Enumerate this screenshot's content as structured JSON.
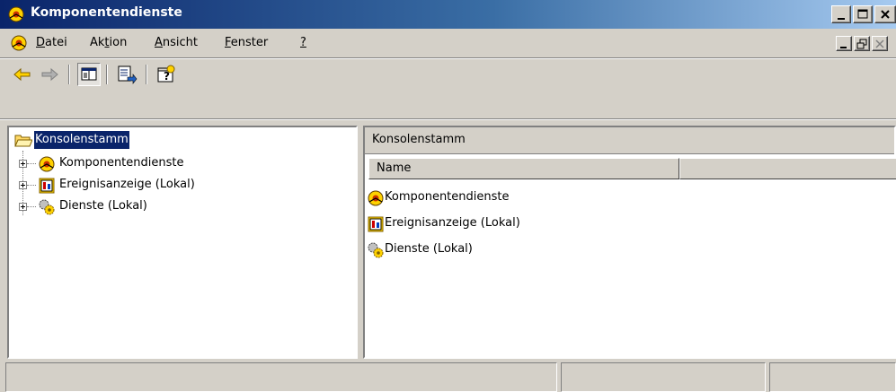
{
  "window": {
    "title": "Komponentendienste",
    "title_bar_color": "#0a246a",
    "app_icon": "component-services-icon"
  },
  "caption_buttons": [
    "minimize-icon",
    "maximize-icon",
    "close-icon"
  ],
  "menu": {
    "doc_icon": "component-services-icon",
    "items": [
      {
        "pre": "",
        "accel": "D",
        "post": "atei"
      },
      {
        "pre": "Ak",
        "accel": "t",
        "post": "ion"
      },
      {
        "pre": "",
        "accel": "A",
        "post": "nsicht"
      },
      {
        "pre": "",
        "accel": "F",
        "post": "enster"
      },
      {
        "pre": "",
        "accel": "?",
        "post": ""
      }
    ],
    "mdi_buttons": [
      "minimize-icon",
      "restore-icon",
      "close-icon"
    ]
  },
  "toolbar": {
    "buttons": [
      "back-arrow-icon",
      "forward-arrow-icon",
      "show-hide-tree-icon",
      "export-list-icon",
      "help-icon"
    ]
  },
  "tree": {
    "root": {
      "label": "Konsolenstamm",
      "icon": "folder-open-icon"
    },
    "items": [
      {
        "label": "Komponentendienste",
        "icon": "component-services-icon"
      },
      {
        "label": "Ereignisanzeige (Lokal)",
        "icon": "event-viewer-icon"
      },
      {
        "label": "Dienste (Lokal)",
        "icon": "services-gears-icon"
      }
    ]
  },
  "detail": {
    "caption": "Konsolenstamm",
    "columns": [
      "Name",
      ""
    ],
    "items": [
      {
        "label": "Komponentendienste",
        "icon": "component-services-icon"
      },
      {
        "label": "Ereignisanzeige (Lokal)",
        "icon": "event-viewer-icon"
      },
      {
        "label": "Dienste (Lokal)",
        "icon": "services-gears-icon"
      }
    ]
  },
  "statusbar": {
    "cells": [
      "",
      "",
      ""
    ]
  },
  "colors": {
    "face": "#d4d0c8",
    "selection": "#0a246a",
    "shadow": "#808080"
  }
}
